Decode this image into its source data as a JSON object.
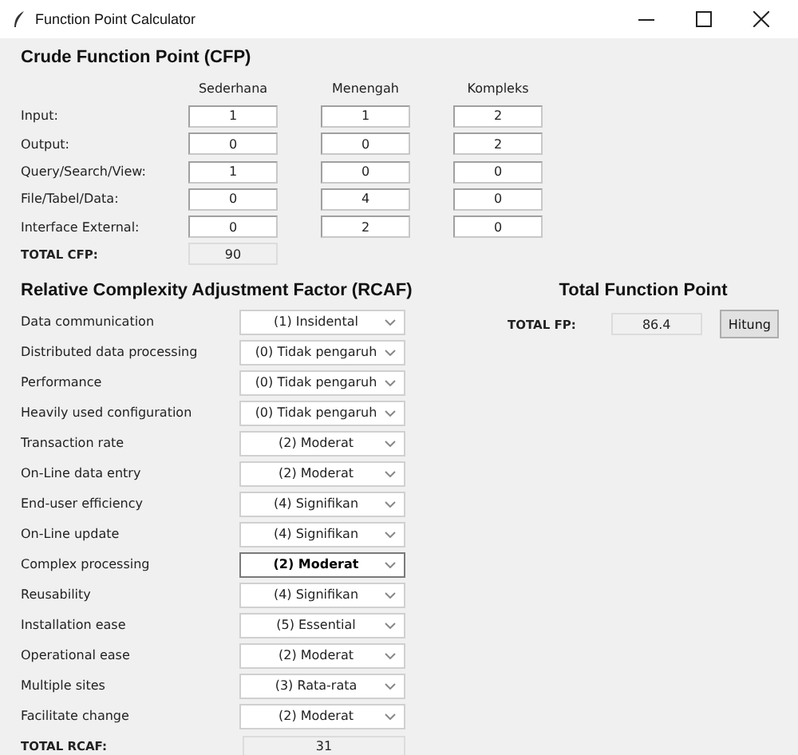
{
  "window": {
    "title": "Function Point Calculator"
  },
  "cfp": {
    "title": "Crude Function Point (CFP)",
    "columns": [
      "Sederhana",
      "Menengah",
      "Kompleks"
    ],
    "rows": [
      {
        "label": "Input:",
        "values": [
          "1",
          "1",
          "2"
        ]
      },
      {
        "label": "Output:",
        "values": [
          "0",
          "0",
          "2"
        ]
      },
      {
        "label": "Query/Search/View:",
        "values": [
          "1",
          "0",
          "0"
        ]
      },
      {
        "label": "File/Tabel/Data:",
        "values": [
          "0",
          "4",
          "0"
        ]
      },
      {
        "label": "Interface External:",
        "values": [
          "0",
          "2",
          "0"
        ]
      }
    ],
    "total_label": "TOTAL CFP:",
    "total_value": "90"
  },
  "rcaf": {
    "title": "Relative Complexity Adjustment Factor (RCAF)",
    "factors": [
      {
        "label": "Data communication",
        "value": "(1) Insidental",
        "focused": false
      },
      {
        "label": "Distributed data processing",
        "value": "(0) Tidak pengaruh",
        "focused": false
      },
      {
        "label": "Performance",
        "value": "(0) Tidak pengaruh",
        "focused": false
      },
      {
        "label": "Heavily used configuration",
        "value": "(0) Tidak pengaruh",
        "focused": false
      },
      {
        "label": "Transaction rate",
        "value": "(2) Moderat",
        "focused": false
      },
      {
        "label": "On-Line data entry",
        "value": "(2) Moderat",
        "focused": false
      },
      {
        "label": "End-user efficiency",
        "value": "(4) Signifikan",
        "focused": false
      },
      {
        "label": "On-Line update",
        "value": "(4) Signifikan",
        "focused": false
      },
      {
        "label": "Complex processing",
        "value": "(2) Moderat",
        "focused": true
      },
      {
        "label": "Reusability",
        "value": "(4) Signifikan",
        "focused": false
      },
      {
        "label": "Installation ease",
        "value": "(5) Essential",
        "focused": false
      },
      {
        "label": "Operational ease",
        "value": "(2) Moderat",
        "focused": false
      },
      {
        "label": "Multiple sites",
        "value": "(3) Rata-rata",
        "focused": false
      },
      {
        "label": "Facilitate change",
        "value": "(2) Moderat",
        "focused": false
      }
    ],
    "total_label": "TOTAL RCAF:",
    "total_value": "31"
  },
  "total_fp": {
    "title": "Total Function Point",
    "label": "TOTAL FP:",
    "value": "86.4",
    "button": "Hitung"
  }
}
